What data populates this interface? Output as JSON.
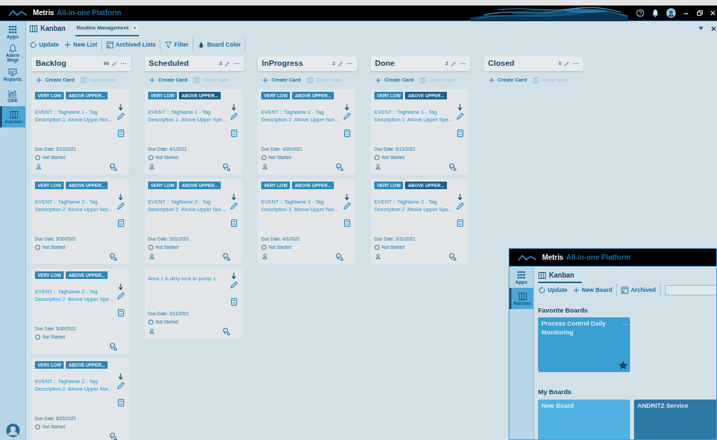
{
  "title_bar": {
    "brand": "Metris",
    "product": "All-in-one Platform"
  },
  "sidebar": {
    "items": [
      {
        "label": "Apps",
        "selected": false
      },
      {
        "label": "Alarm Mngt",
        "selected": false
      },
      {
        "label": "Reports",
        "selected": false
      },
      {
        "label": "OEE",
        "selected": false
      },
      {
        "label": "Kanban",
        "selected": true
      }
    ]
  },
  "app_title": "Kanban",
  "tabs": [
    {
      "label": "Routine Management",
      "close": "×",
      "selected": true
    }
  ],
  "toolbar": [
    [
      "Update",
      "New List"
    ],
    [
      "Archived Lists"
    ],
    [
      "Filter"
    ],
    [
      "Board Color"
    ]
  ],
  "lists": [
    {
      "name": "Backlog",
      "count": "94",
      "menu": "···",
      "create_label": "Create Card",
      "clone_label": "Clone Card",
      "cards": [
        {
          "tags": [
            {
              "label": "VERY LOW",
              "color": "#2f86b8"
            },
            {
              "label": "ABOVE UPPER...",
              "color": "#2f86b8"
            }
          ],
          "title_lines": [
            "EVENT :: TagName 1 - Tag",
            "Description 1  Above Upper Nor..."
          ],
          "due": "Due Date: 5/13/2021",
          "status": "Not Started",
          "assignee": true
        },
        {
          "tags": [
            {
              "label": "VERY LOW",
              "color": "#2f86b8"
            },
            {
              "label": "ABOVE UPPER...",
              "color": "#2f86b8"
            }
          ],
          "title_lines": [
            "EVENT :: TagName 2 - Tag",
            "Description 2  Above Upper Nor..."
          ],
          "due": "Due Date: 5/30/2021",
          "status": "Not Started",
          "assignee": false
        },
        {
          "tags": [
            {
              "label": "VERY LOW",
              "color": "#2f86b8"
            },
            {
              "label": "ABOVE UPPER...",
              "color": "#2f86b8"
            }
          ],
          "title_lines": [
            "EVENT :: TagName 2 - Tag",
            "Description 2  Above Upper Spe..."
          ],
          "due": "Due Date: 5/30/2021",
          "status": "Not Started",
          "assignee": false
        },
        {
          "tags": [
            {
              "label": "VERY LOW",
              "color": "#2f86b8"
            },
            {
              "label": "ABOVE UPPER...",
              "color": "#2f86b8"
            }
          ],
          "title_lines": [
            "EVENT :: TagName 2 - Tag",
            "Description 2  Above Upper Nor..."
          ],
          "due": "Due Date: 8/23/2021",
          "status": "Not Started"
        }
      ]
    },
    {
      "name": "Scheduled",
      "count": "3",
      "menu": "···",
      "create_label": "Create Card",
      "clone_label": "Clone Card",
      "cards": [
        {
          "tags": [
            {
              "label": "VERY LOW",
              "color": "#2f86b8"
            },
            {
              "label": "ABOVE UPPER...",
              "color": "#1f5f86"
            }
          ],
          "title_lines": [
            "EVENT :: TagName 1 - Tag",
            "Description 1  Above Upper Spe..."
          ],
          "due": "Due Date: 4/1/2021",
          "status": "Not Started",
          "assignee": true
        },
        {
          "tags": [
            {
              "label": "VERY LOW",
              "color": "#2f86b8"
            },
            {
              "label": "ABOVE UPPER...",
              "color": "#2f86b8"
            }
          ],
          "title_lines": [
            "EVENT :: TagName 2 - Tag",
            "Description 2  Above Upper Nor..."
          ],
          "due": "Due Date: 3/31/2021",
          "status": "Not Started",
          "assignee": true
        },
        {
          "title_lines": [
            "Area 1 is dirty next to pump 1"
          ],
          "due": "Due Date: 3/11/2021",
          "status": "Not Started",
          "assignee": true
        }
      ]
    },
    {
      "name": "InProgress",
      "count": "2",
      "menu": "···",
      "create_label": "Create Card",
      "clone_label": "Clone Card",
      "cards": [
        {
          "tags": [
            {
              "label": "VERY LOW",
              "color": "#2f86b8"
            },
            {
              "label": "ABOVE UPPER...",
              "color": "#2f86b8"
            }
          ],
          "title_lines": [
            "EVENT :: TagName 2 - Tag",
            "Description 2  Above Upper Nor..."
          ],
          "due": "Due Date: 4/20/2021",
          "status": "Not Started",
          "assignee": true
        },
        {
          "tags": [
            {
              "label": "VERY LOW",
              "color": "#2f86b8"
            },
            {
              "label": "ABOVE UPPER...",
              "color": "#2f86b8"
            }
          ],
          "title_lines": [
            "EVENT :: TagName 1 - Tag",
            "Description 1  Above Upper Nor..."
          ],
          "due": "Due Date: 4/1/2021",
          "status": "Not Started",
          "assignee": true
        }
      ]
    },
    {
      "name": "Done",
      "count": "2",
      "menu": "···",
      "create_label": "Create Card",
      "clone_label": "Clone Card",
      "cards": [
        {
          "tags": [
            {
              "label": "VERY LOW",
              "color": "#2f86b8"
            },
            {
              "label": "ABOVE UPPER...",
              "color": "#1f5f86"
            }
          ],
          "title_lines": [
            "EVENT :: TagName 1 - Tag",
            "Description 1  Above Upper Spe..."
          ],
          "due": "Due Date: 5/13/2021",
          "status": "Not Started",
          "assignee": true
        },
        {
          "tags": [
            {
              "label": "VERY LOW",
              "color": "#2f86b8"
            },
            {
              "label": "ABOVE UPPER...",
              "color": "#1f5f86"
            }
          ],
          "title_lines": [
            "EVENT :: TagName 2 - Tag",
            "Description 2  Above Upper Spe..."
          ],
          "due": "Due Date: 3/31/2021",
          "status": "Not Started",
          "assignee": true
        }
      ]
    },
    {
      "name": "Closed",
      "count": "0",
      "menu": "···",
      "create_label": "Create Card",
      "clone_label": "Clone Card"
    }
  ],
  "second_window": {
    "brand": "Metris",
    "product": "All-in-one Platform",
    "sidebar": {
      "items": [
        {
          "label": "Apps",
          "selected": false
        },
        {
          "label": "Kanban",
          "selected": true
        }
      ]
    },
    "app_title": "Kanban",
    "toolbar": [
      [
        "Update",
        "New Board"
      ],
      [
        "Archived"
      ]
    ],
    "sections": [
      {
        "heading": "Favorite Boards",
        "boards": [
          {
            "name": "Process Control Daily Monitoring",
            "color": "#3a9fd2",
            "menu": "...",
            "starred": true
          }
        ]
      },
      {
        "heading": "My Boards",
        "boards": [
          {
            "name": "New Board",
            "color": "#4fb2e2"
          },
          {
            "name": "ANDRITZ Service",
            "color": "#2e78a6"
          }
        ]
      }
    ]
  }
}
